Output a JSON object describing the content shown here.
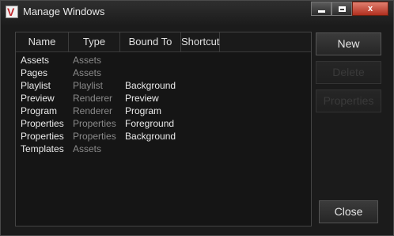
{
  "window": {
    "title": "Manage Windows"
  },
  "titlebar_buttons": {
    "minimize": "",
    "maximize": "",
    "close": "x"
  },
  "list": {
    "columns": [
      "Name",
      "Type",
      "Bound To",
      "Shortcut"
    ],
    "rows": [
      {
        "name": "Assets",
        "type": "Assets",
        "bound_to": "",
        "shortcut": ""
      },
      {
        "name": "Pages",
        "type": "Assets",
        "bound_to": "",
        "shortcut": ""
      },
      {
        "name": "Playlist",
        "type": "Playlist",
        "bound_to": "Background",
        "shortcut": ""
      },
      {
        "name": "Preview",
        "type": "Renderer",
        "bound_to": "Preview",
        "shortcut": ""
      },
      {
        "name": "Program",
        "type": "Renderer",
        "bound_to": "Program",
        "shortcut": ""
      },
      {
        "name": "Properties",
        "type": "Properties",
        "bound_to": "Foreground",
        "shortcut": ""
      },
      {
        "name": "Properties",
        "type": "Properties",
        "bound_to": "Background",
        "shortcut": ""
      },
      {
        "name": "Templates",
        "type": "Assets",
        "bound_to": "",
        "shortcut": ""
      }
    ]
  },
  "buttons": {
    "new": "New",
    "delete": "Delete",
    "properties": "Properties",
    "close": "Close"
  }
}
